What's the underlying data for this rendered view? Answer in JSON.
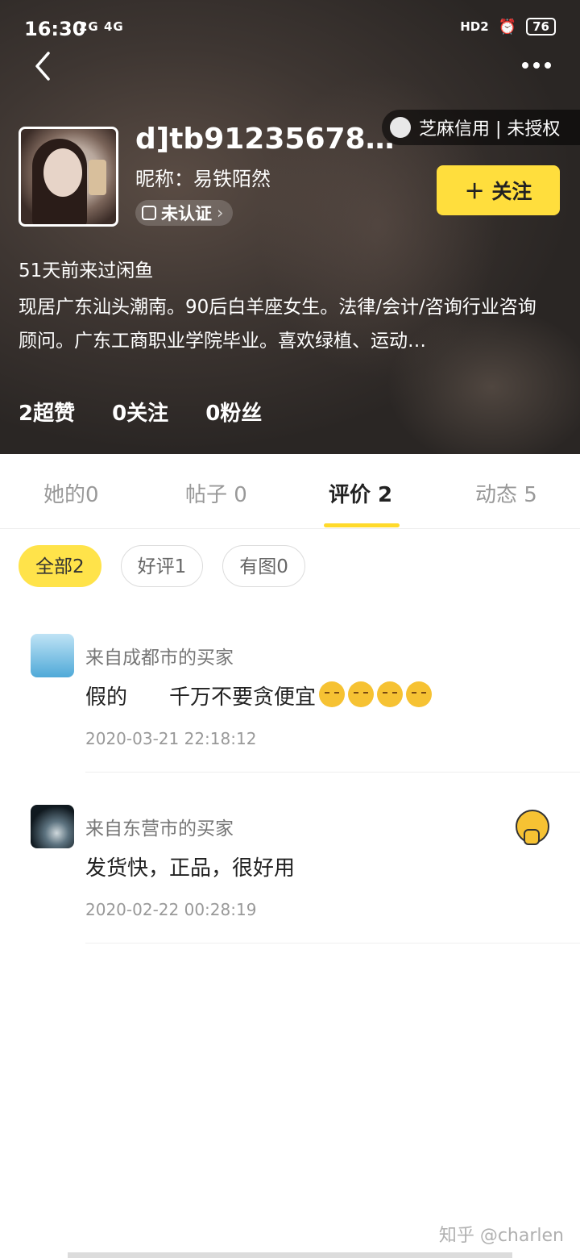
{
  "status_bar": {
    "time": "16:30",
    "network": "2G 4G",
    "hd": "HD2",
    "battery": "76"
  },
  "profile": {
    "username": "d]tb91235678…",
    "nickname": "昵称：易铁陌然",
    "verify_label": "未认证",
    "credit_label": "芝麻信用 | 未授权",
    "follow_label": "＋ 关注",
    "visited": "51天前来过闲鱼",
    "bio": "现居广东汕头潮南。90后白羊座女生。法律/会计/咨询行业咨询顾问。广东工商职业学院毕业。喜欢绿植、运动…",
    "stats": [
      "2超赞",
      "0关注",
      "0粉丝"
    ]
  },
  "tabs": [
    "她的0",
    "帖子 0",
    "评价 2",
    "动态 5"
  ],
  "filters": [
    "全部2",
    "好评1",
    "有图0"
  ],
  "reviews": [
    {
      "who": "来自成都市的买家",
      "text": "假的　　千万不要贪便宜",
      "date": "2020-03-21 22:18:12"
    },
    {
      "who": "来自东营市的买家",
      "text": "发货快，正品，很好用",
      "date": "2020-02-22 00:28:19"
    }
  ],
  "watermark": "知乎 @charlen",
  "colors": {
    "accent": "#ffde3d",
    "tab_underline": "#ffda2b"
  }
}
